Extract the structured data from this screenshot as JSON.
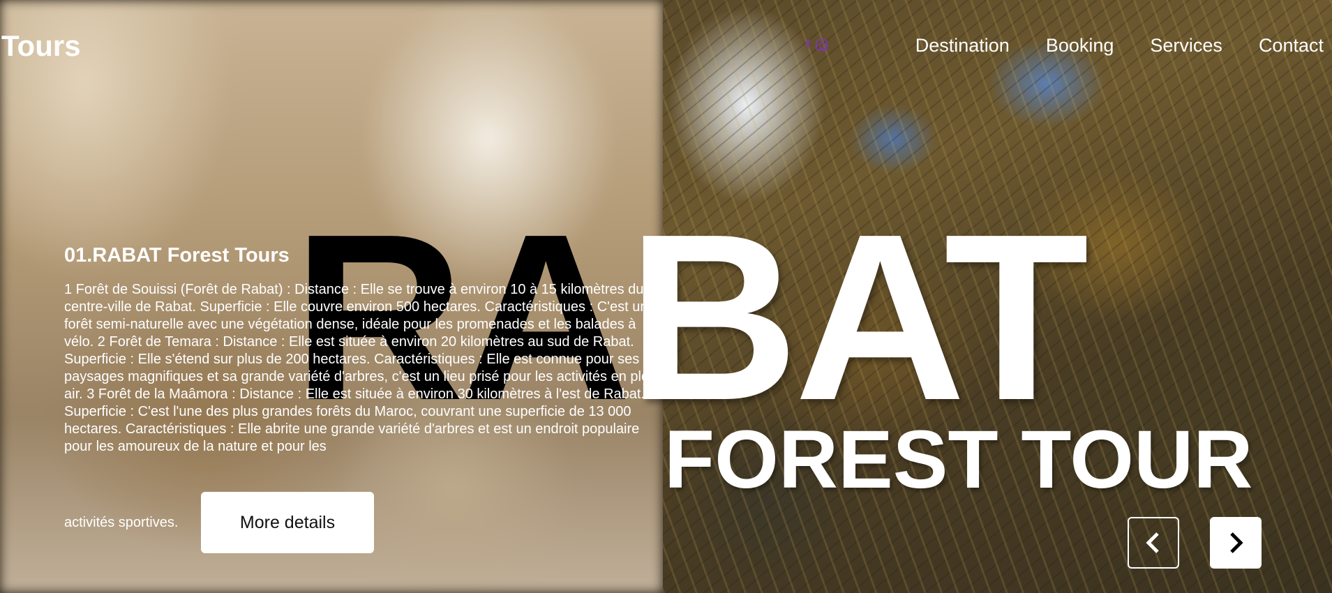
{
  "header": {
    "logo": "Tours",
    "social_icons": [
      "facebook-icon",
      "instagram-icon"
    ],
    "social_color": "#7a3aa0",
    "nav": [
      "Destination",
      "Booking",
      "Services",
      "Contact"
    ]
  },
  "hero": {
    "title_dark": "RA",
    "title_light": "BAT",
    "subtitle": "FOREST TOUR"
  },
  "content": {
    "heading": "01.RABAT Forest Tours",
    "paragraph": "1 Forêt de Souissi (Forêt de Rabat) : Distance : Elle se trouve à environ 10 à 15 kilomètres du centre-ville de Rabat. Superficie : Elle couvre environ 500 hectares. Caractéristiques : C'est une forêt semi-naturelle avec une végétation dense, idéale pour les promenades et les balades à vélo. 2 Forêt de Temara : Distance : Elle est située à environ 20 kilomètres au sud de Rabat. Superficie : Elle s'étend sur plus de 200 hectares. Caractéristiques : Elle est connue pour ses paysages magnifiques et sa grande variété d'arbres, c'est un lieu prisé pour les activités en plein air. 3 Forêt de la Maâmora : Distance : Elle est située à environ 30 kilomètres à l'est de Rabat. Superficie : C'est l'une des plus grandes forêts du Maroc, couvrant une superficie de 13 000 hectares. Caractéristiques : Elle abrite une grande variété d'arbres et est un endroit populaire pour les amoureux de la nature et pour les",
    "last_line": "activités sportives.",
    "button": "More details"
  },
  "slider": {
    "prev_icon": "chevron-left-icon",
    "next_icon": "chevron-right-icon"
  }
}
